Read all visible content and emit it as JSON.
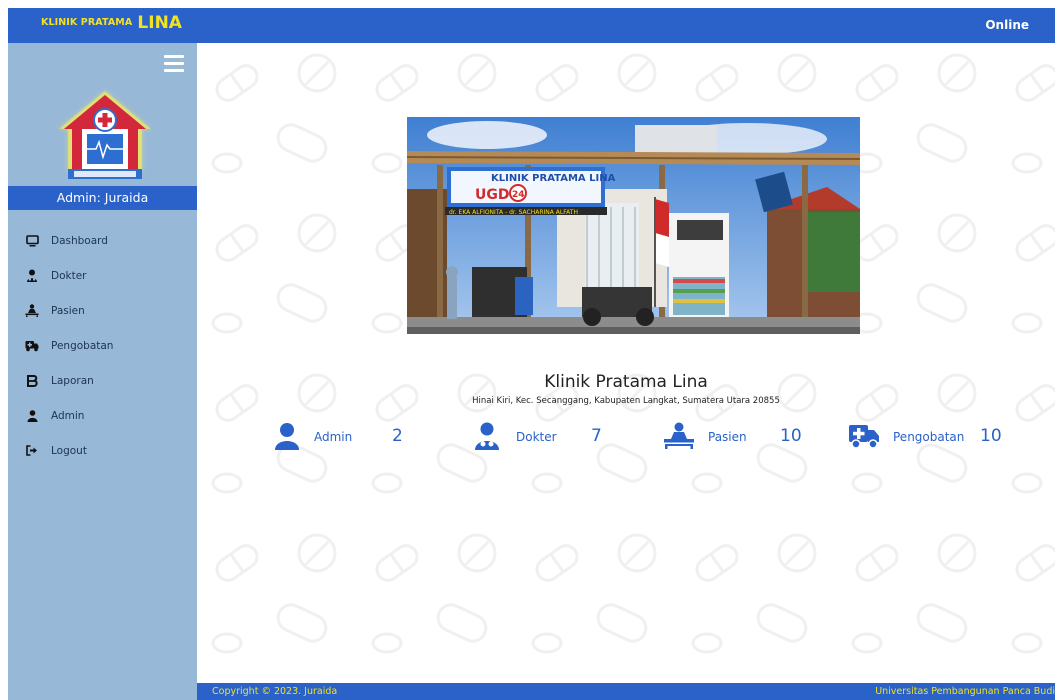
{
  "header": {
    "brand_small": "KLINIK PRATAMA",
    "brand_big": "LINA",
    "status": "Online"
  },
  "sidebar": {
    "admin_label": "Admin: Juraida",
    "items": [
      {
        "label": "Dashboard",
        "icon": "monitor-icon"
      },
      {
        "label": "Dokter",
        "icon": "doctor-icon"
      },
      {
        "label": "Pasien",
        "icon": "patient-icon"
      },
      {
        "label": "Pengobatan",
        "icon": "ambulance-icon"
      },
      {
        "label": "Laporan",
        "icon": "bold-icon"
      },
      {
        "label": "Admin",
        "icon": "user-icon"
      },
      {
        "label": "Logout",
        "icon": "logout-icon"
      }
    ]
  },
  "main": {
    "clinic_name": "Klinik Pratama Lina",
    "clinic_address": "Hinai Kiri, Kec. Secanggang, Kabupaten Langkat, Sumatera Utara 20855",
    "photo": {
      "sign_title": "KLINIK PRATAMA LINA",
      "sign_ugd": "UGD",
      "sign_24": "24",
      "sign_doctors": "dr. EKA ALFIONITA  -  dr. SACHARINA ALFATH"
    },
    "stats": [
      {
        "label": "Admin",
        "value": "2",
        "icon": "user-icon"
      },
      {
        "label": "Dokter",
        "value": "7",
        "icon": "doctor-icon"
      },
      {
        "label": "Pasien",
        "value": "10",
        "icon": "patient-bed-icon"
      },
      {
        "label": "Pengobatan",
        "value": "10",
        "icon": "ambulance-icon"
      }
    ]
  },
  "footer": {
    "copyright": "Copyright © 2023. Juraida",
    "university": "Universitas Pembangunan Panca Budi"
  },
  "colors": {
    "primary": "#2a62c9",
    "sidebar": "#98b8d8",
    "accent_yellow": "#f3e21e"
  }
}
